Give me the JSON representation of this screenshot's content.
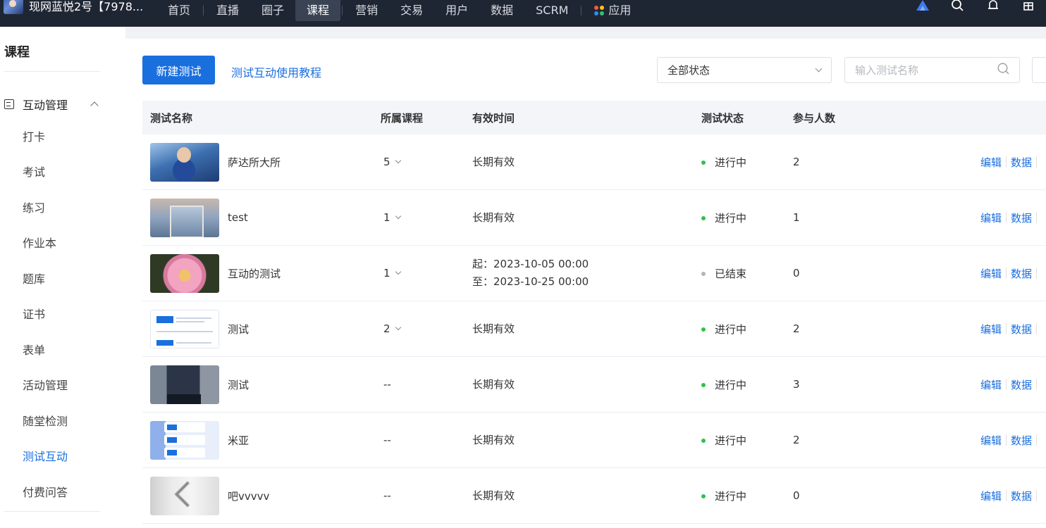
{
  "topnav": {
    "brand": "现网蓝悦2号【7978...",
    "items": [
      "首页",
      "直播",
      "圈子",
      "课程",
      "营销",
      "交易",
      "用户",
      "数据",
      "SCRM",
      "应用"
    ],
    "active": "课程"
  },
  "sidebar": {
    "title": "课程",
    "group": "互动管理",
    "items": [
      "打卡",
      "考试",
      "练习",
      "作业本",
      "题库",
      "证书",
      "表单",
      "活动管理",
      "随堂检测",
      "测试互动",
      "付费问答"
    ],
    "active": "测试互动"
  },
  "toolbar": {
    "new_button": "新建测试",
    "tutorial_link": "测试互动使用教程",
    "status_select": "全部状态",
    "search_placeholder": "输入测试名称"
  },
  "table": {
    "headers": {
      "name": "测试名称",
      "course": "所属课程",
      "time": "有效时间",
      "status": "测试状态",
      "count": "参与人数"
    },
    "rows": [
      {
        "name": "萨达所大所",
        "course": "5",
        "time1": "长期有效",
        "time2": "",
        "status": "进行中",
        "count": "2"
      },
      {
        "name": "test",
        "course": "1",
        "time1": "长期有效",
        "time2": "",
        "status": "进行中",
        "count": "1"
      },
      {
        "name": "互动的测试",
        "course": "1",
        "time1": "起：2023-10-05 00:00",
        "time2": "至：2023-10-25 00:00",
        "status": "已结束",
        "count": "0"
      },
      {
        "name": "测试",
        "course": "2",
        "time1": "长期有效",
        "time2": "",
        "status": "进行中",
        "count": "2"
      },
      {
        "name": "测试",
        "course": "--",
        "time1": "长期有效",
        "time2": "",
        "status": "进行中",
        "count": "3"
      },
      {
        "name": "米亚",
        "course": "--",
        "time1": "长期有效",
        "time2": "",
        "status": "进行中",
        "count": "2"
      },
      {
        "name": "吧vvvvv",
        "course": "--",
        "time1": "长期有效",
        "time2": "",
        "status": "进行中",
        "count": "0"
      }
    ],
    "ops": {
      "edit": "编辑",
      "data": "数据"
    }
  },
  "colors": {
    "accent": "#1a6fdf",
    "status_active": "#2ec24a",
    "status_ended": "#b4b4b4",
    "nav_bg": "#1f2633"
  },
  "icons": [
    "brand-logo",
    "app-grid-icon",
    "ai-logo-icon",
    "search-icon",
    "bell-icon",
    "gift-icon",
    "module-icon",
    "chevron-up-icon",
    "chevron-down-icon"
  ]
}
